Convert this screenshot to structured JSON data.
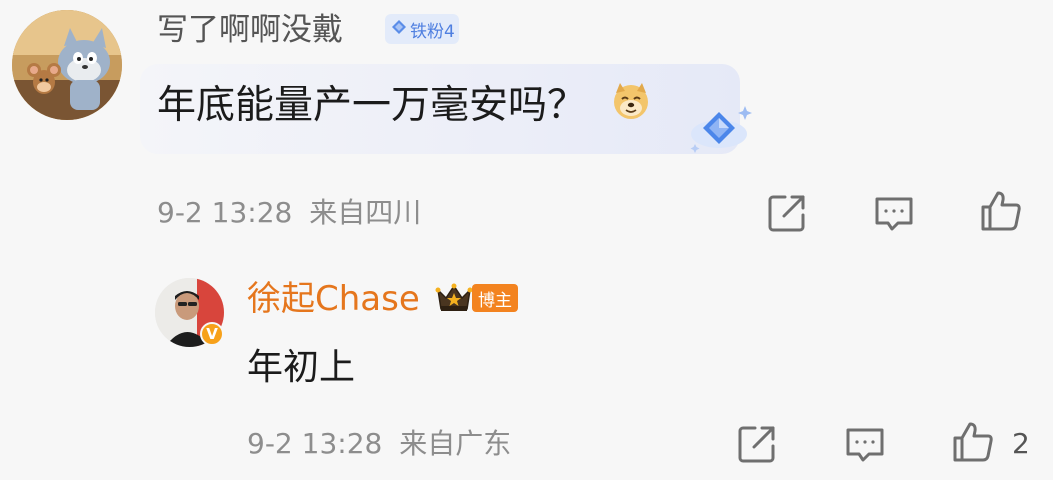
{
  "comment": {
    "username": "写了啊啊没戴",
    "fan_badge": "铁粉4",
    "text": "年底能量产一万毫安吗？",
    "emoji_icon": "doge-emoji-icon",
    "timestamp": "9-2 13:28",
    "location": "来自四川",
    "colors": {
      "username": "#555555",
      "badge_bg": "#e3ebfa",
      "badge_text": "#4f7fe0"
    }
  },
  "reply": {
    "username": "徐起Chase",
    "role_badge": "博主",
    "text": "年初上",
    "verified_badge": "V",
    "timestamp": "9-2 13:28",
    "location": "来自广东",
    "like_count": "2",
    "colors": {
      "username": "#e5761d",
      "badge_bg": "#f3831f"
    }
  },
  "actions": {
    "share_icon": "share-icon",
    "comment_icon": "comment-icon",
    "like_icon": "thumbs-up-icon"
  }
}
